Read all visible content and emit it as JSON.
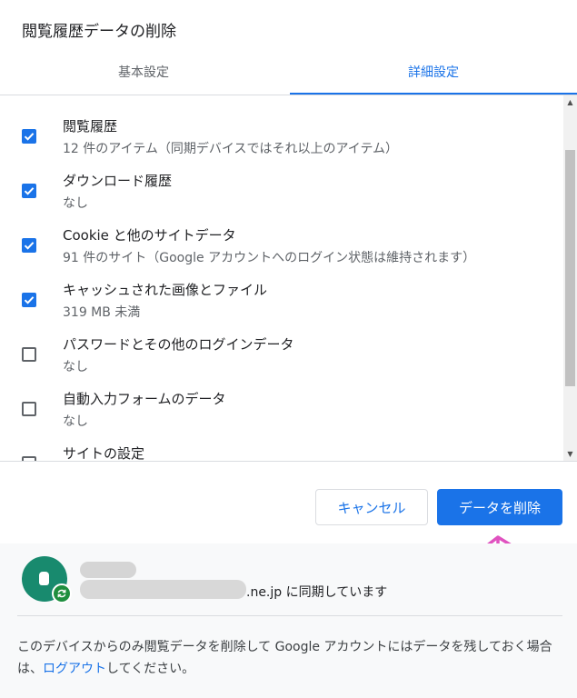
{
  "dialog": {
    "title": "閲覧履歴データの削除"
  },
  "tabs": [
    {
      "label": "基本設定",
      "active": false
    },
    {
      "label": "詳細設定",
      "active": true
    }
  ],
  "items": [
    {
      "label": "閲覧履歴",
      "sub": "12 件のアイテム（同期デバイスではそれ以上のアイテム）",
      "checked": true
    },
    {
      "label": "ダウンロード履歴",
      "sub": "なし",
      "checked": true
    },
    {
      "label": "Cookie と他のサイトデータ",
      "sub": "91 件のサイト（Google アカウントへのログイン状態は維持されます）",
      "checked": true
    },
    {
      "label": "キャッシュされた画像とファイル",
      "sub": "319 MB 未満",
      "checked": true
    },
    {
      "label": "パスワードとその他のログインデータ",
      "sub": "なし",
      "checked": false
    },
    {
      "label": "自動入力フォームのデータ",
      "sub": "なし",
      "checked": false
    },
    {
      "label": "サイトの設定",
      "sub": "",
      "checked": false
    }
  ],
  "buttons": {
    "cancel": "キャンセル",
    "delete": "データを削除"
  },
  "footer": {
    "sync_text": ".ne.jp に同期しています",
    "note_prefix": "このデバイスからのみ閲覧データを削除して Google アカウントにはデータを残しておく場合は、",
    "note_link": "ログアウト",
    "note_suffix": "してください。"
  },
  "colors": {
    "accent": "#1a73e8",
    "annotation_arrow": "#e052c0",
    "avatar": "#188a6e",
    "sync_badge": "#1e8e3e"
  },
  "icons": {
    "checkbox_checked": "check-icon",
    "sync": "sync-icon",
    "scroll_up": "scroll-up-arrow-icon",
    "scroll_down": "scroll-down-arrow-icon",
    "annotation": "up-arrow-annotation-icon"
  }
}
